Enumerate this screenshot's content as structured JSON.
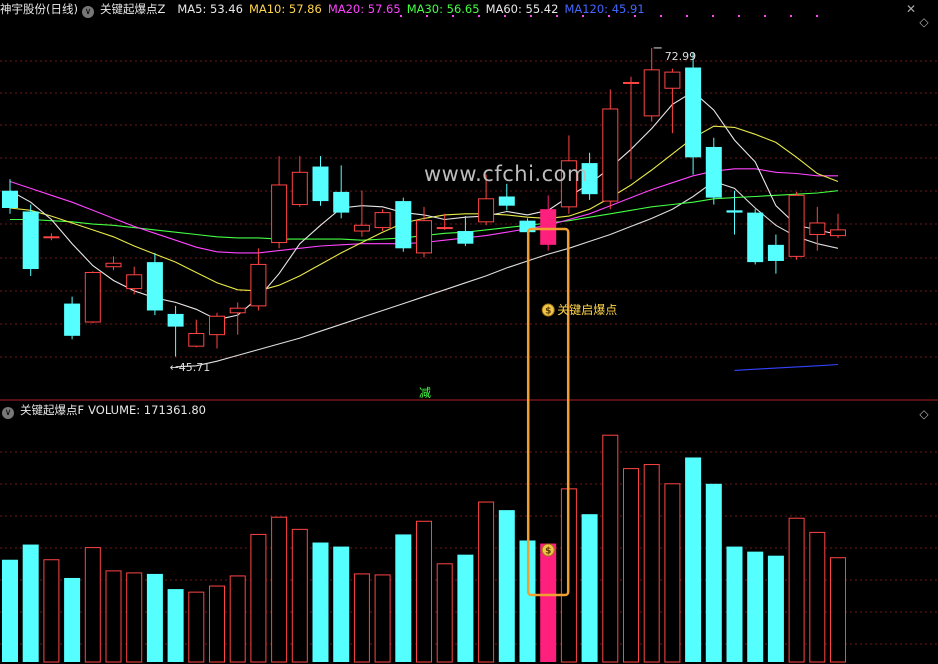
{
  "header_top": {
    "stock": "神宇股份(日线)",
    "indicator": "关键起爆点Z",
    "ma": [
      {
        "label": "MA5: 53.46",
        "color": "#e8e8e8"
      },
      {
        "label": "MA10: 57.86",
        "color": "#ffd54a"
      },
      {
        "label": "MA20: 57.65",
        "color": "#ff44ff"
      },
      {
        "label": "MA30: 56.65",
        "color": "#44ff44"
      },
      {
        "label": "MA60: 55.42",
        "color": "#e8e8e8"
      },
      {
        "label": "MA120: 45.91",
        "color": "#4466ff"
      }
    ]
  },
  "header_bottom": {
    "indicator": "关键起爆点F",
    "volume": "VOLUME: 171361.80"
  },
  "annotations": {
    "high_price": "72.99",
    "low_price": "45.71",
    "signal_label": "关键启爆点",
    "reduce_label": "减"
  },
  "watermark": "www.cfchi.com",
  "colors": {
    "up": "#ff4444",
    "down": "#55ffff",
    "signal": "#ff1f7c",
    "highlight": "#f0a030",
    "grid": "#6a1a1a",
    "ma5": "#e8e8e8",
    "ma10": "#e8e84a",
    "ma20": "#ff44ff",
    "ma30": "#44ff44",
    "ma60": "#dddddd",
    "ma120": "#3344ff"
  },
  "chart_data": {
    "type": "candlestick",
    "price_range": [
      43,
      76
    ],
    "volume_range": [
      0,
      240
    ],
    "candles": [
      {
        "o": 61.0,
        "c": 59.5,
        "h": 62.0,
        "l": 59.0,
        "v": 101
      },
      {
        "o": 59.2,
        "c": 54.2,
        "h": 59.8,
        "l": 53.6,
        "v": 116
      },
      {
        "o": 57.0,
        "c": 57.0,
        "h": 57.3,
        "l": 56.7,
        "v": 101
      },
      {
        "o": 51.2,
        "c": 48.4,
        "h": 51.8,
        "l": 48.1,
        "v": 83
      },
      {
        "o": 49.6,
        "c": 53.9,
        "h": 54.0,
        "l": 49.5,
        "v": 113
      },
      {
        "o": 54.4,
        "c": 54.7,
        "h": 55.3,
        "l": 54.1,
        "v": 90
      },
      {
        "o": 52.5,
        "c": 53.7,
        "h": 54.4,
        "l": 52.0,
        "v": 88
      },
      {
        "o": 54.8,
        "c": 50.6,
        "h": 55.6,
        "l": 50.2,
        "v": 87
      },
      {
        "o": 50.3,
        "c": 49.2,
        "h": 51.0,
        "l": 46.6,
        "v": 72
      },
      {
        "o": 47.5,
        "c": 48.6,
        "h": 49.8,
        "l": 47.4,
        "v": 69
      },
      {
        "o": 48.5,
        "c": 50.1,
        "h": 50.4,
        "l": 47.3,
        "v": 75
      },
      {
        "o": 50.4,
        "c": 50.8,
        "h": 51.3,
        "l": 48.5,
        "v": 85
      },
      {
        "o": 51.0,
        "c": 54.6,
        "h": 56.0,
        "l": 50.6,
        "v": 126
      },
      {
        "o": 56.5,
        "c": 61.5,
        "h": 64.0,
        "l": 56.0,
        "v": 143
      },
      {
        "o": 59.8,
        "c": 62.6,
        "h": 64.0,
        "l": 59.6,
        "v": 131
      },
      {
        "o": 63.1,
        "c": 60.1,
        "h": 64.0,
        "l": 59.7,
        "v": 118
      },
      {
        "o": 60.9,
        "c": 59.1,
        "h": 63.2,
        "l": 58.6,
        "v": 114
      },
      {
        "o": 57.5,
        "c": 58.0,
        "h": 61.0,
        "l": 57.0,
        "v": 87
      },
      {
        "o": 57.8,
        "c": 59.1,
        "h": 59.4,
        "l": 57.5,
        "v": 86
      },
      {
        "o": 60.1,
        "c": 56.0,
        "h": 60.4,
        "l": 55.7,
        "v": 126
      },
      {
        "o": 55.6,
        "c": 58.4,
        "h": 59.6,
        "l": 55.2,
        "v": 139
      },
      {
        "o": 57.8,
        "c": 57.8,
        "h": 59.0,
        "l": 57.6,
        "v": 97
      },
      {
        "o": 57.5,
        "c": 56.4,
        "h": 58.8,
        "l": 56.2,
        "v": 106
      },
      {
        "o": 58.3,
        "c": 60.3,
        "h": 62.4,
        "l": 58.0,
        "v": 158
      },
      {
        "o": 60.5,
        "c": 59.7,
        "h": 61.6,
        "l": 59.3,
        "v": 150
      },
      {
        "o": 58.4,
        "c": 57.4,
        "h": 58.6,
        "l": 56.8,
        "v": 120
      },
      {
        "o": 56.3,
        "c": 59.4,
        "h": 60.6,
        "l": 55.8,
        "v": 117,
        "signal": true
      },
      {
        "o": 59.6,
        "c": 63.6,
        "h": 65.8,
        "l": 59.0,
        "v": 171
      },
      {
        "o": 63.4,
        "c": 60.7,
        "h": 64.3,
        "l": 60.2,
        "v": 146
      },
      {
        "o": 60.1,
        "c": 68.1,
        "h": 69.8,
        "l": 59.4,
        "v": 224
      },
      {
        "o": 70.4,
        "c": 70.4,
        "h": 70.9,
        "l": 62.0,
        "v": 191
      },
      {
        "o": 67.5,
        "c": 71.5,
        "h": 73.4,
        "l": 67.0,
        "v": 195
      },
      {
        "o": 69.9,
        "c": 71.3,
        "h": 71.6,
        "l": 66.0,
        "v": 176
      },
      {
        "o": 71.7,
        "c": 63.9,
        "h": 72.99,
        "l": 62.4,
        "v": 202
      },
      {
        "o": 64.8,
        "c": 60.4,
        "h": 65.6,
        "l": 59.8,
        "v": 176
      },
      {
        "o": 59.3,
        "c": 59.1,
        "h": 61.0,
        "l": 57.2,
        "v": 114
      },
      {
        "o": 59.1,
        "c": 54.8,
        "h": 59.4,
        "l": 54.6,
        "v": 109
      },
      {
        "o": 56.3,
        "c": 54.9,
        "h": 57.2,
        "l": 53.8,
        "v": 105
      },
      {
        "o": 55.3,
        "c": 60.6,
        "h": 60.9,
        "l": 55.0,
        "v": 142
      },
      {
        "o": 57.2,
        "c": 58.2,
        "h": 59.6,
        "l": 55.8,
        "v": 128
      },
      {
        "o": 57.1,
        "c": 57.6,
        "h": 59.0,
        "l": 56.9,
        "v": 103
      }
    ],
    "ma5": [
      61.0,
      60.0,
      58.5,
      56.4,
      54.5,
      53.2,
      52.3,
      51.7,
      51.3,
      50.7,
      49.8,
      50.2,
      51.7,
      53.8,
      56.4,
      58.0,
      59.5,
      59.7,
      59.6,
      59.1,
      58.9,
      58.5,
      58.7,
      58.8,
      59.2,
      58.9,
      59.3,
      60.5,
      61.6,
      63.0,
      64.6,
      66.4,
      68.5,
      69.6,
      68.0,
      65.4,
      63.5,
      59.7,
      58.0,
      57.6,
      57.2
    ],
    "ma10": [
      59.5,
      59.3,
      58.8,
      58.2,
      57.6,
      57.0,
      56.2,
      55.5,
      54.8,
      53.9,
      53.0,
      52.4,
      52.3,
      52.8,
      53.6,
      54.6,
      55.6,
      56.5,
      57.4,
      58.2,
      58.6,
      58.9,
      59.0,
      59.0,
      58.9,
      58.7,
      58.6,
      58.8,
      59.4,
      60.4,
      61.5,
      62.8,
      64.2,
      65.6,
      66.6,
      66.5,
      65.9,
      65.2,
      63.9,
      62.5,
      61.8
    ],
    "ma20": [
      61.8,
      61.2,
      60.6,
      60.0,
      59.3,
      58.6,
      57.9,
      57.3,
      56.7,
      56.1,
      55.7,
      55.6,
      55.6,
      55.8,
      56.0,
      56.2,
      56.3,
      56.4,
      56.4,
      56.4,
      56.5,
      56.7,
      56.9,
      57.1,
      57.4,
      57.7,
      58.0,
      58.5,
      59.0,
      59.7,
      60.4,
      61.1,
      61.7,
      62.3,
      62.7,
      62.9,
      62.9,
      62.6,
      62.5,
      62.3,
      62.3
    ],
    "ma30": [
      58.5,
      58.5,
      58.4,
      58.3,
      58.1,
      58.0,
      57.8,
      57.6,
      57.4,
      57.2,
      57.0,
      56.9,
      56.9,
      56.8,
      56.8,
      56.8,
      56.8,
      56.7,
      56.8,
      56.9,
      57.1,
      57.3,
      57.4,
      57.6,
      57.8,
      58.0,
      58.2,
      58.4,
      58.7,
      59.0,
      59.3,
      59.6,
      59.8,
      60.0,
      60.3,
      60.4,
      60.5,
      60.6,
      60.7,
      60.8,
      61.0
    ],
    "ma60": [
      null,
      null,
      null,
      null,
      null,
      null,
      null,
      null,
      45.71,
      45.8,
      46.2,
      46.7,
      47.2,
      47.7,
      48.2,
      48.8,
      49.4,
      50.0,
      50.6,
      51.2,
      51.8,
      52.4,
      53.0,
      53.6,
      54.3,
      54.9,
      55.5,
      56.0,
      56.6,
      57.2,
      57.9,
      58.6,
      59.4,
      60.5,
      61.8,
      61.2,
      59.5,
      58.0,
      57.0,
      56.4,
      56.0
    ],
    "ma120": [
      null,
      null,
      null,
      null,
      null,
      null,
      null,
      null,
      null,
      null,
      null,
      null,
      null,
      null,
      null,
      null,
      null,
      null,
      null,
      null,
      null,
      null,
      null,
      null,
      null,
      null,
      null,
      null,
      null,
      null,
      null,
      null,
      null,
      null,
      null,
      45.4,
      45.5,
      45.6,
      45.7,
      45.8,
      45.91
    ]
  }
}
